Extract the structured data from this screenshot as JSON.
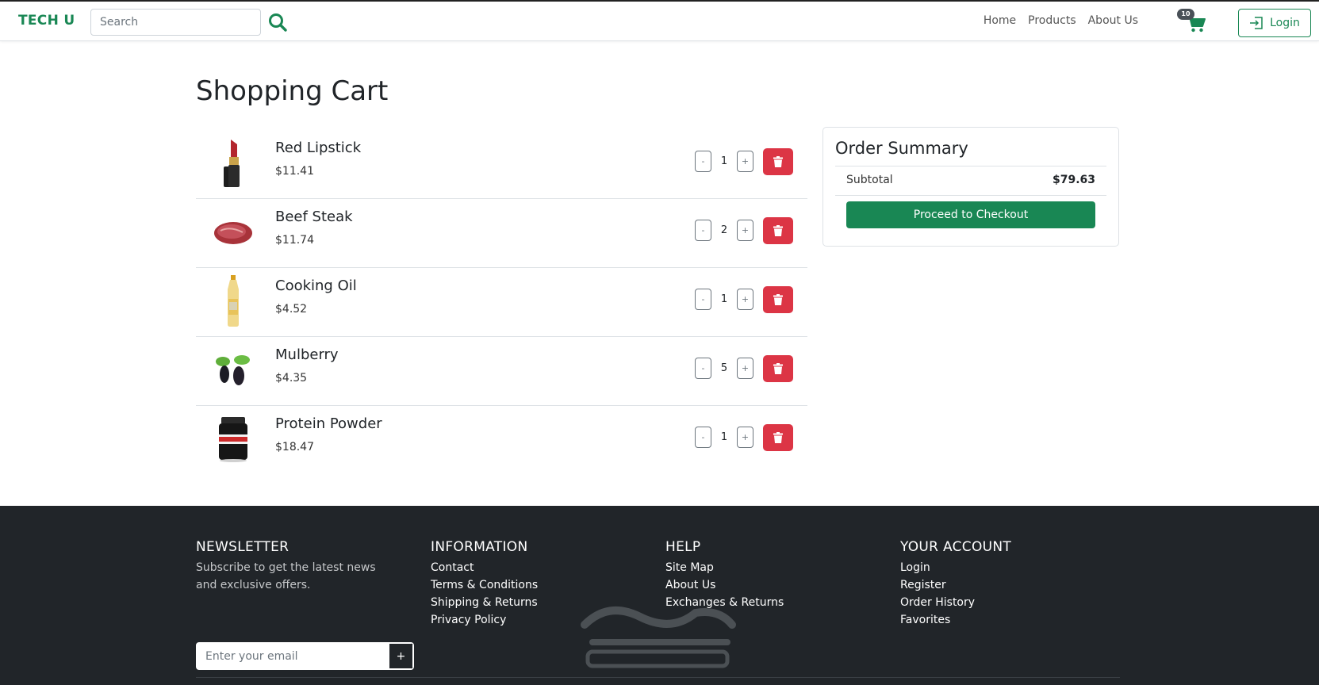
{
  "navbar": {
    "brand": "TECH U",
    "search_placeholder": "Search",
    "links": [
      "Home",
      "Products",
      "About Us"
    ],
    "cart_count": "10",
    "login_label": "Login"
  },
  "colors": {
    "accent": "#198754",
    "danger": "#dc3545",
    "footer_bg": "#212529"
  },
  "page_title": "Shopping Cart",
  "cart_items": [
    {
      "name": "Red Lipstick",
      "price": "$11.41",
      "qty": "1",
      "icon": "lipstick-icon"
    },
    {
      "name": "Beef Steak",
      "price": "$11.74",
      "qty": "2",
      "icon": "steak-icon"
    },
    {
      "name": "Cooking Oil",
      "price": "$4.52",
      "qty": "1",
      "icon": "oil-bottle-icon"
    },
    {
      "name": "Mulberry",
      "price": "$4.35",
      "qty": "5",
      "icon": "mulberry-icon"
    },
    {
      "name": "Protein Powder",
      "price": "$18.47",
      "qty": "1",
      "icon": "protein-tub-icon"
    }
  ],
  "qty_controls": {
    "minus": "-",
    "plus": "+"
  },
  "summary": {
    "title": "Order Summary",
    "subtotal_label": "Subtotal",
    "subtotal_value": "$79.63",
    "checkout_label": "Proceed to Checkout"
  },
  "footer": {
    "newsletter": {
      "title": "NEWSLETTER",
      "desc": "Subscribe to get the latest news and exclusive offers.",
      "email_placeholder": "Enter your email",
      "submit_label": "+"
    },
    "information": {
      "title": "INFORMATION",
      "links": [
        "Contact",
        "Terms & Conditions",
        "Shipping & Returns",
        "Privacy Policy"
      ]
    },
    "help": {
      "title": "HELP",
      "links": [
        "Site Map",
        "About Us",
        "Exchanges & Returns"
      ]
    },
    "account": {
      "title": "YOUR ACCOUNT",
      "links": [
        "Login",
        "Register",
        "Order History",
        "Favorites"
      ]
    }
  }
}
